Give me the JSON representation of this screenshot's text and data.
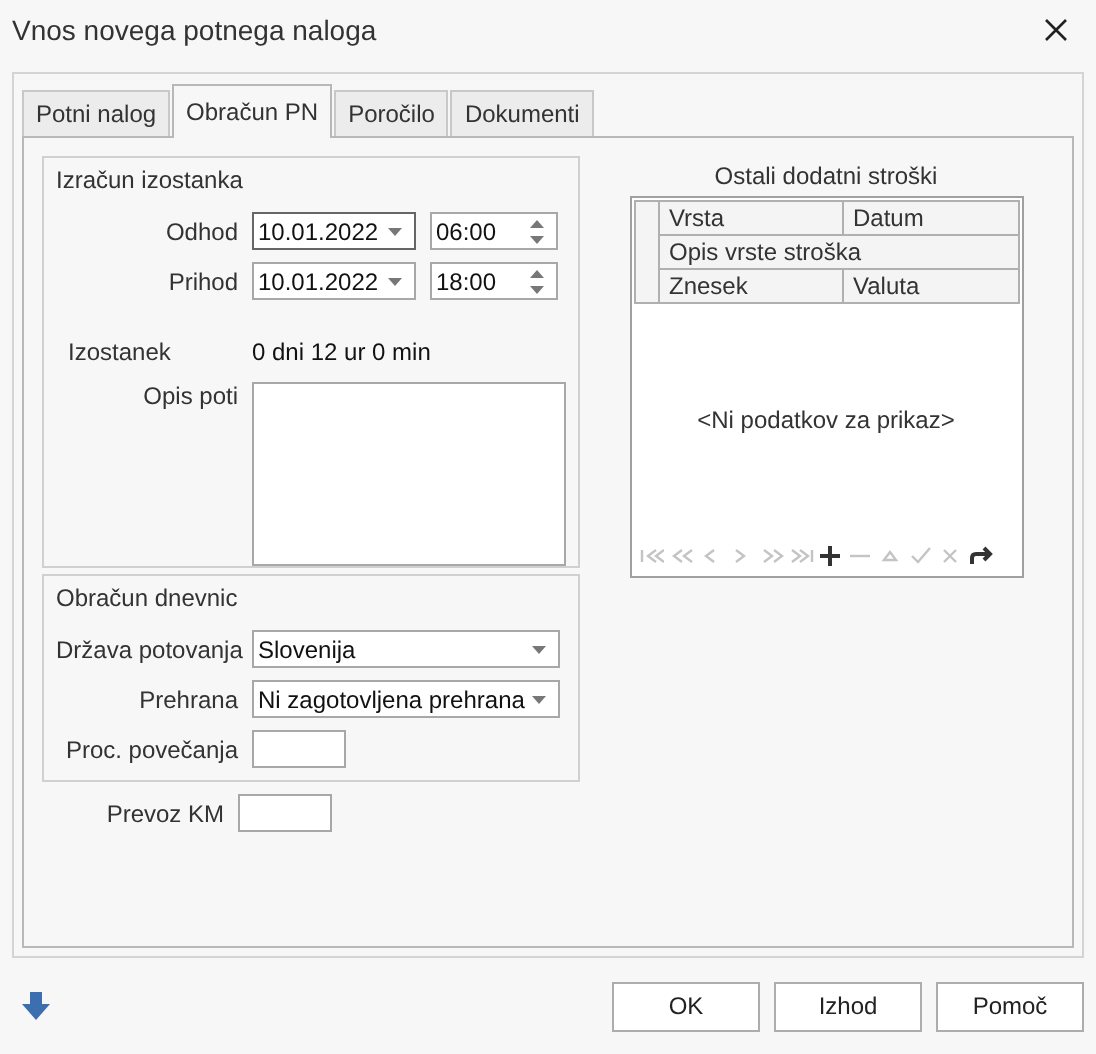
{
  "window": {
    "title": "Vnos novega potnega naloga"
  },
  "tabs": [
    {
      "label": "Potni nalog",
      "selected": false
    },
    {
      "label": "Obračun PN",
      "selected": true
    },
    {
      "label": "Poročilo",
      "selected": false
    },
    {
      "label": "Dokumenti",
      "selected": false
    }
  ],
  "izracun": {
    "title": "Izračun izostanka",
    "departure": {
      "label": "Odhod",
      "date": "10.01.2022",
      "time": "06:00"
    },
    "arrival": {
      "label": "Prihod",
      "date": "10.01.2022",
      "time": "18:00"
    },
    "absence": {
      "label": "Izostanek",
      "value": "0 dni 12 ur 0 min"
    },
    "route_description": {
      "label": "Opis poti"
    }
  },
  "dnevnice": {
    "title": "Obračun dnevnic",
    "country": {
      "label": "Država potovanja",
      "value": "Slovenija"
    },
    "meals": {
      "label": "Prehrana",
      "value": "Ni zagotovljena prehrana"
    },
    "increase_percent": {
      "label": "Proc. povečanja"
    }
  },
  "transport_km": {
    "label": "Prevoz KM"
  },
  "costs": {
    "title": "Ostali dodatni stroški",
    "header_rows": [
      [
        "Vrsta",
        "Datum"
      ],
      [
        "Opis vrste stroška"
      ],
      [
        "Znesek",
        "Valuta"
      ]
    ],
    "empty_text": "<Ni podatkov za prikaz>",
    "navigator": [
      {
        "kind": "first",
        "disabled": true
      },
      {
        "kind": "prev-page",
        "disabled": true
      },
      {
        "kind": "prev",
        "disabled": true
      },
      {
        "kind": "next",
        "disabled": true
      },
      {
        "kind": "next-page",
        "disabled": true
      },
      {
        "kind": "last",
        "disabled": true
      },
      {
        "kind": "add",
        "disabled": false
      },
      {
        "kind": "remove",
        "disabled": true
      },
      {
        "kind": "edit",
        "disabled": true
      },
      {
        "kind": "save",
        "disabled": true
      },
      {
        "kind": "cancel",
        "disabled": true
      },
      {
        "kind": "refresh",
        "disabled": false
      }
    ]
  },
  "buttons": [
    {
      "label": "OK"
    },
    {
      "label": "Izhod"
    },
    {
      "label": "Pomoč"
    }
  ]
}
